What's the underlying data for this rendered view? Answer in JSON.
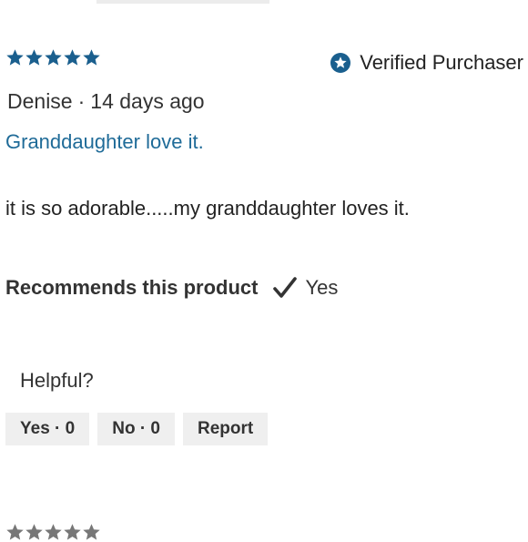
{
  "review": {
    "rating_stars": 5,
    "verified_label": "Verified Purchaser",
    "reviewer": "Denise",
    "separator": "·",
    "date": "14 days ago",
    "title": "Granddaughter love it.",
    "body": "it is so adorable.....my granddaughter loves it.",
    "recommends_label": "Recommends this product",
    "recommends_value": "Yes"
  },
  "helpful": {
    "label": "Helpful?",
    "yes_button": "Yes · 0",
    "no_button": "No · 0",
    "report_button": "Report"
  },
  "colors": {
    "star": "#1a5f8e",
    "title_link": "#1f6b98",
    "button_bg": "#efefef"
  },
  "icons": {
    "rating": "star-icon",
    "verified": "verified-badge-icon",
    "recommend": "checkmark-icon"
  }
}
